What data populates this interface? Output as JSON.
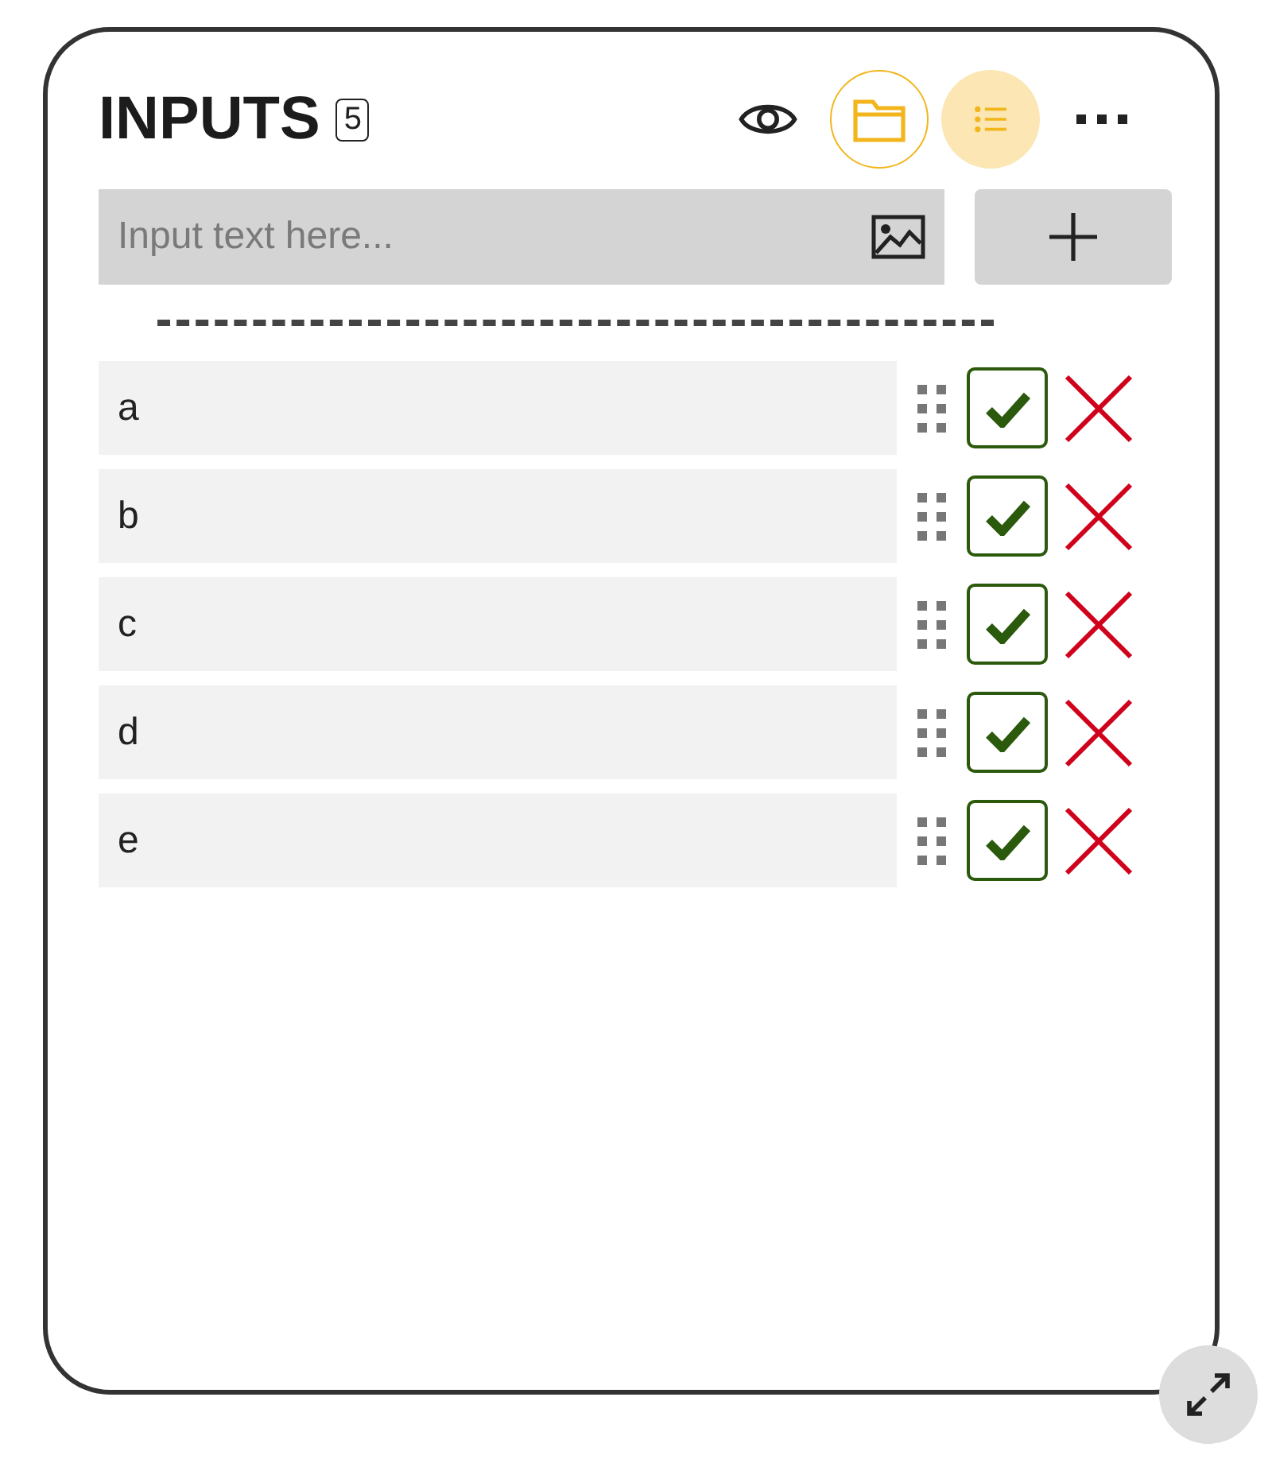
{
  "header": {
    "title": "INPUTS",
    "count": "5"
  },
  "toolbar": [
    {
      "kind": "eye",
      "selected": false
    },
    {
      "kind": "folder",
      "selected": false
    },
    {
      "kind": "list",
      "selected": true
    },
    {
      "kind": "more",
      "selected": false
    }
  ],
  "new_input": {
    "placeholder": "Input text here..."
  },
  "items": [
    {
      "text": "a",
      "checked": true
    },
    {
      "text": "b",
      "checked": true
    },
    {
      "text": "c",
      "checked": true
    },
    {
      "text": "d",
      "checked": true
    },
    {
      "text": "e",
      "checked": true
    }
  ]
}
